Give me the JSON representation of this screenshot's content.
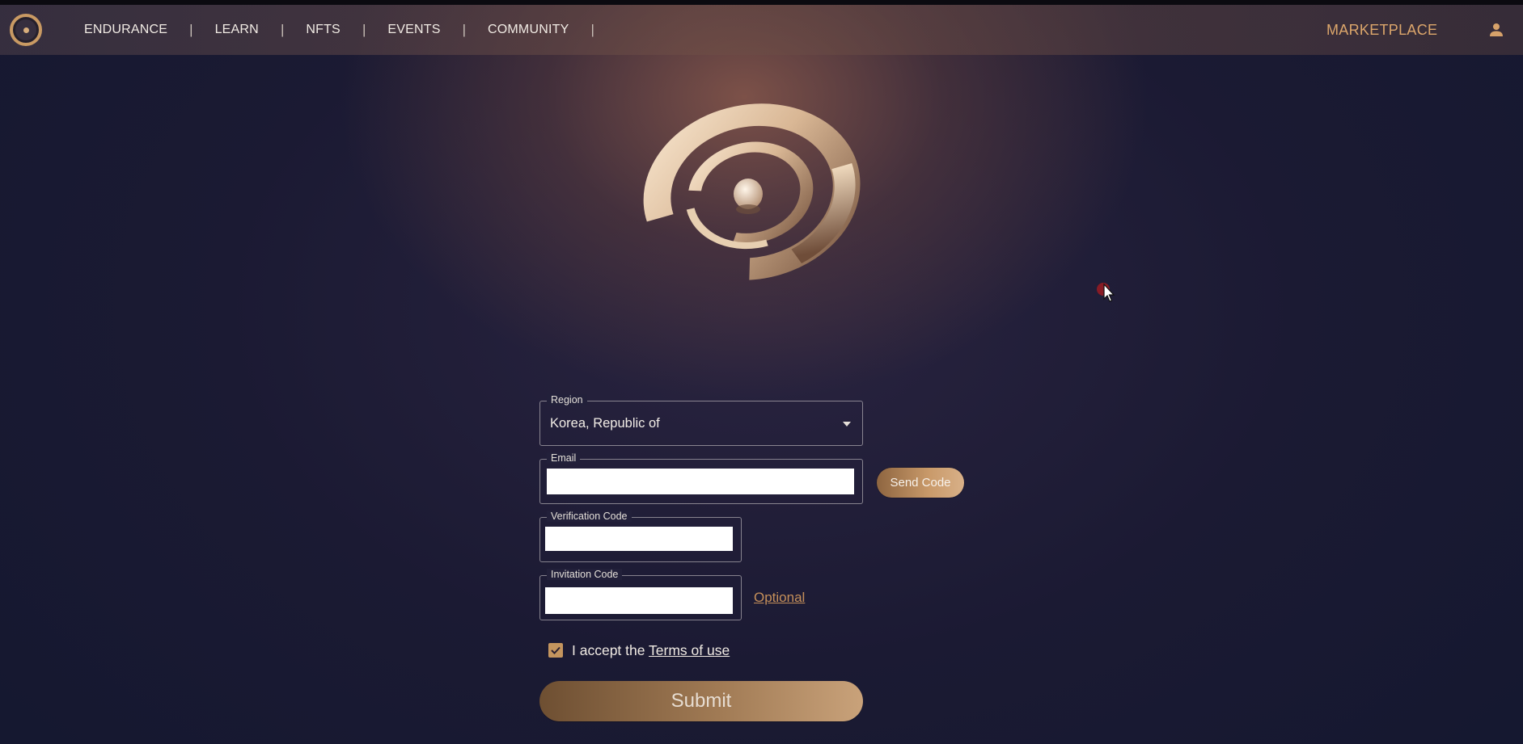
{
  "nav": {
    "items": [
      "ENDURANCE",
      "LEARN",
      "NFTS",
      "EVENTS",
      "COMMUNITY"
    ],
    "separator": "|",
    "marketplace": "MARKETPLACE",
    "accent_color": "#dca66b"
  },
  "icons": {
    "brand_logo": "brand-logo-icon",
    "user": "user-icon",
    "dropdown": "caret-down-icon",
    "checkmark": "checkmark-icon",
    "cursor": "mouse-pointer-icon"
  },
  "form": {
    "region": {
      "label": "Region",
      "value": "Korea, Republic of"
    },
    "email": {
      "label": "Email",
      "value": ""
    },
    "send_code": "Send Code",
    "verification": {
      "label": "Verification Code",
      "value": ""
    },
    "invitation": {
      "label": "Invitation Code",
      "value": ""
    },
    "optional": "Optional",
    "terms": {
      "prefix": "I accept the ",
      "link": "Terms of use",
      "checked": true
    },
    "submit": "Submit"
  }
}
